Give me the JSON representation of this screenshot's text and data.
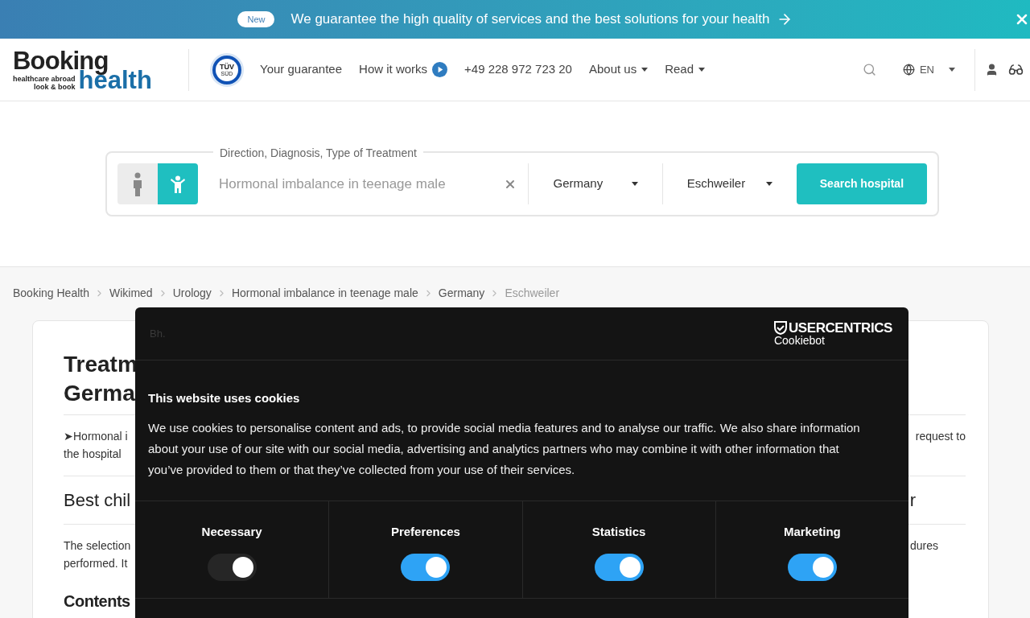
{
  "banner": {
    "badge": "New",
    "text": "We guarantee the high quality of services and the best solutions for your health"
  },
  "header": {
    "logo": {
      "word1": "Booking",
      "word2": "health",
      "tagline1": "healthcare abroad",
      "tagline2": "look & book"
    },
    "seal": {
      "line1": "TÜV",
      "line2": "SÜD"
    },
    "nav": [
      {
        "label": "Your guarantee",
        "kind": "link"
      },
      {
        "label": "How it works",
        "kind": "play"
      },
      {
        "label": "+49 228 972 723 20",
        "kind": "link"
      },
      {
        "label": "About us",
        "kind": "menu"
      },
      {
        "label": "Read",
        "kind": "menu"
      }
    ],
    "language": "EN"
  },
  "search": {
    "legend": "Direction, Diagnosis, Type of Treatment",
    "patient": [
      {
        "kind": "adult",
        "selected": false
      },
      {
        "kind": "child",
        "selected": true
      }
    ],
    "value": "Hormonal imbalance in teenage male",
    "country": "Germany",
    "city": "Eschweiler",
    "button": "Search hospital"
  },
  "breadcrumbs": [
    {
      "label": "Booking Health",
      "current": false
    },
    {
      "label": "Wikimed",
      "current": false
    },
    {
      "label": "Urology",
      "current": false
    },
    {
      "label": "Hormonal imbalance in teenage male",
      "current": false
    },
    {
      "label": "Germany",
      "current": false
    },
    {
      "label": "Eschweiler",
      "current": true
    }
  ],
  "article": {
    "title_lines": [
      "Treatm",
      "Germa"
    ],
    "intro_left": [
      "➤Hormonal i",
      "the hospital"
    ],
    "intro_right": "request to",
    "heading_left": "Best chil",
    "heading_right": "r",
    "para_left": [
      "The selection",
      "performed. It"
    ],
    "para_right": "dures",
    "contents": "Contents"
  },
  "cookie": {
    "brand": "Bh.",
    "vendor1": "USERCENTRICS",
    "vendor2": "Cookiebot",
    "title": "This website uses cookies",
    "text": "We use cookies to personalise content and ads, to provide social media features and to analyse our traffic. We also share information about your use of our site with our social media, advertising and analytics partners who may combine it with other information that you’ve provided to them or that they’ve collected from your use of their services.",
    "categories": [
      {
        "label": "Necessary",
        "on": true,
        "disabled": true
      },
      {
        "label": "Preferences",
        "on": true,
        "disabled": false
      },
      {
        "label": "Statistics",
        "on": true,
        "disabled": false
      },
      {
        "label": "Marketing",
        "on": true,
        "disabled": false
      }
    ]
  }
}
